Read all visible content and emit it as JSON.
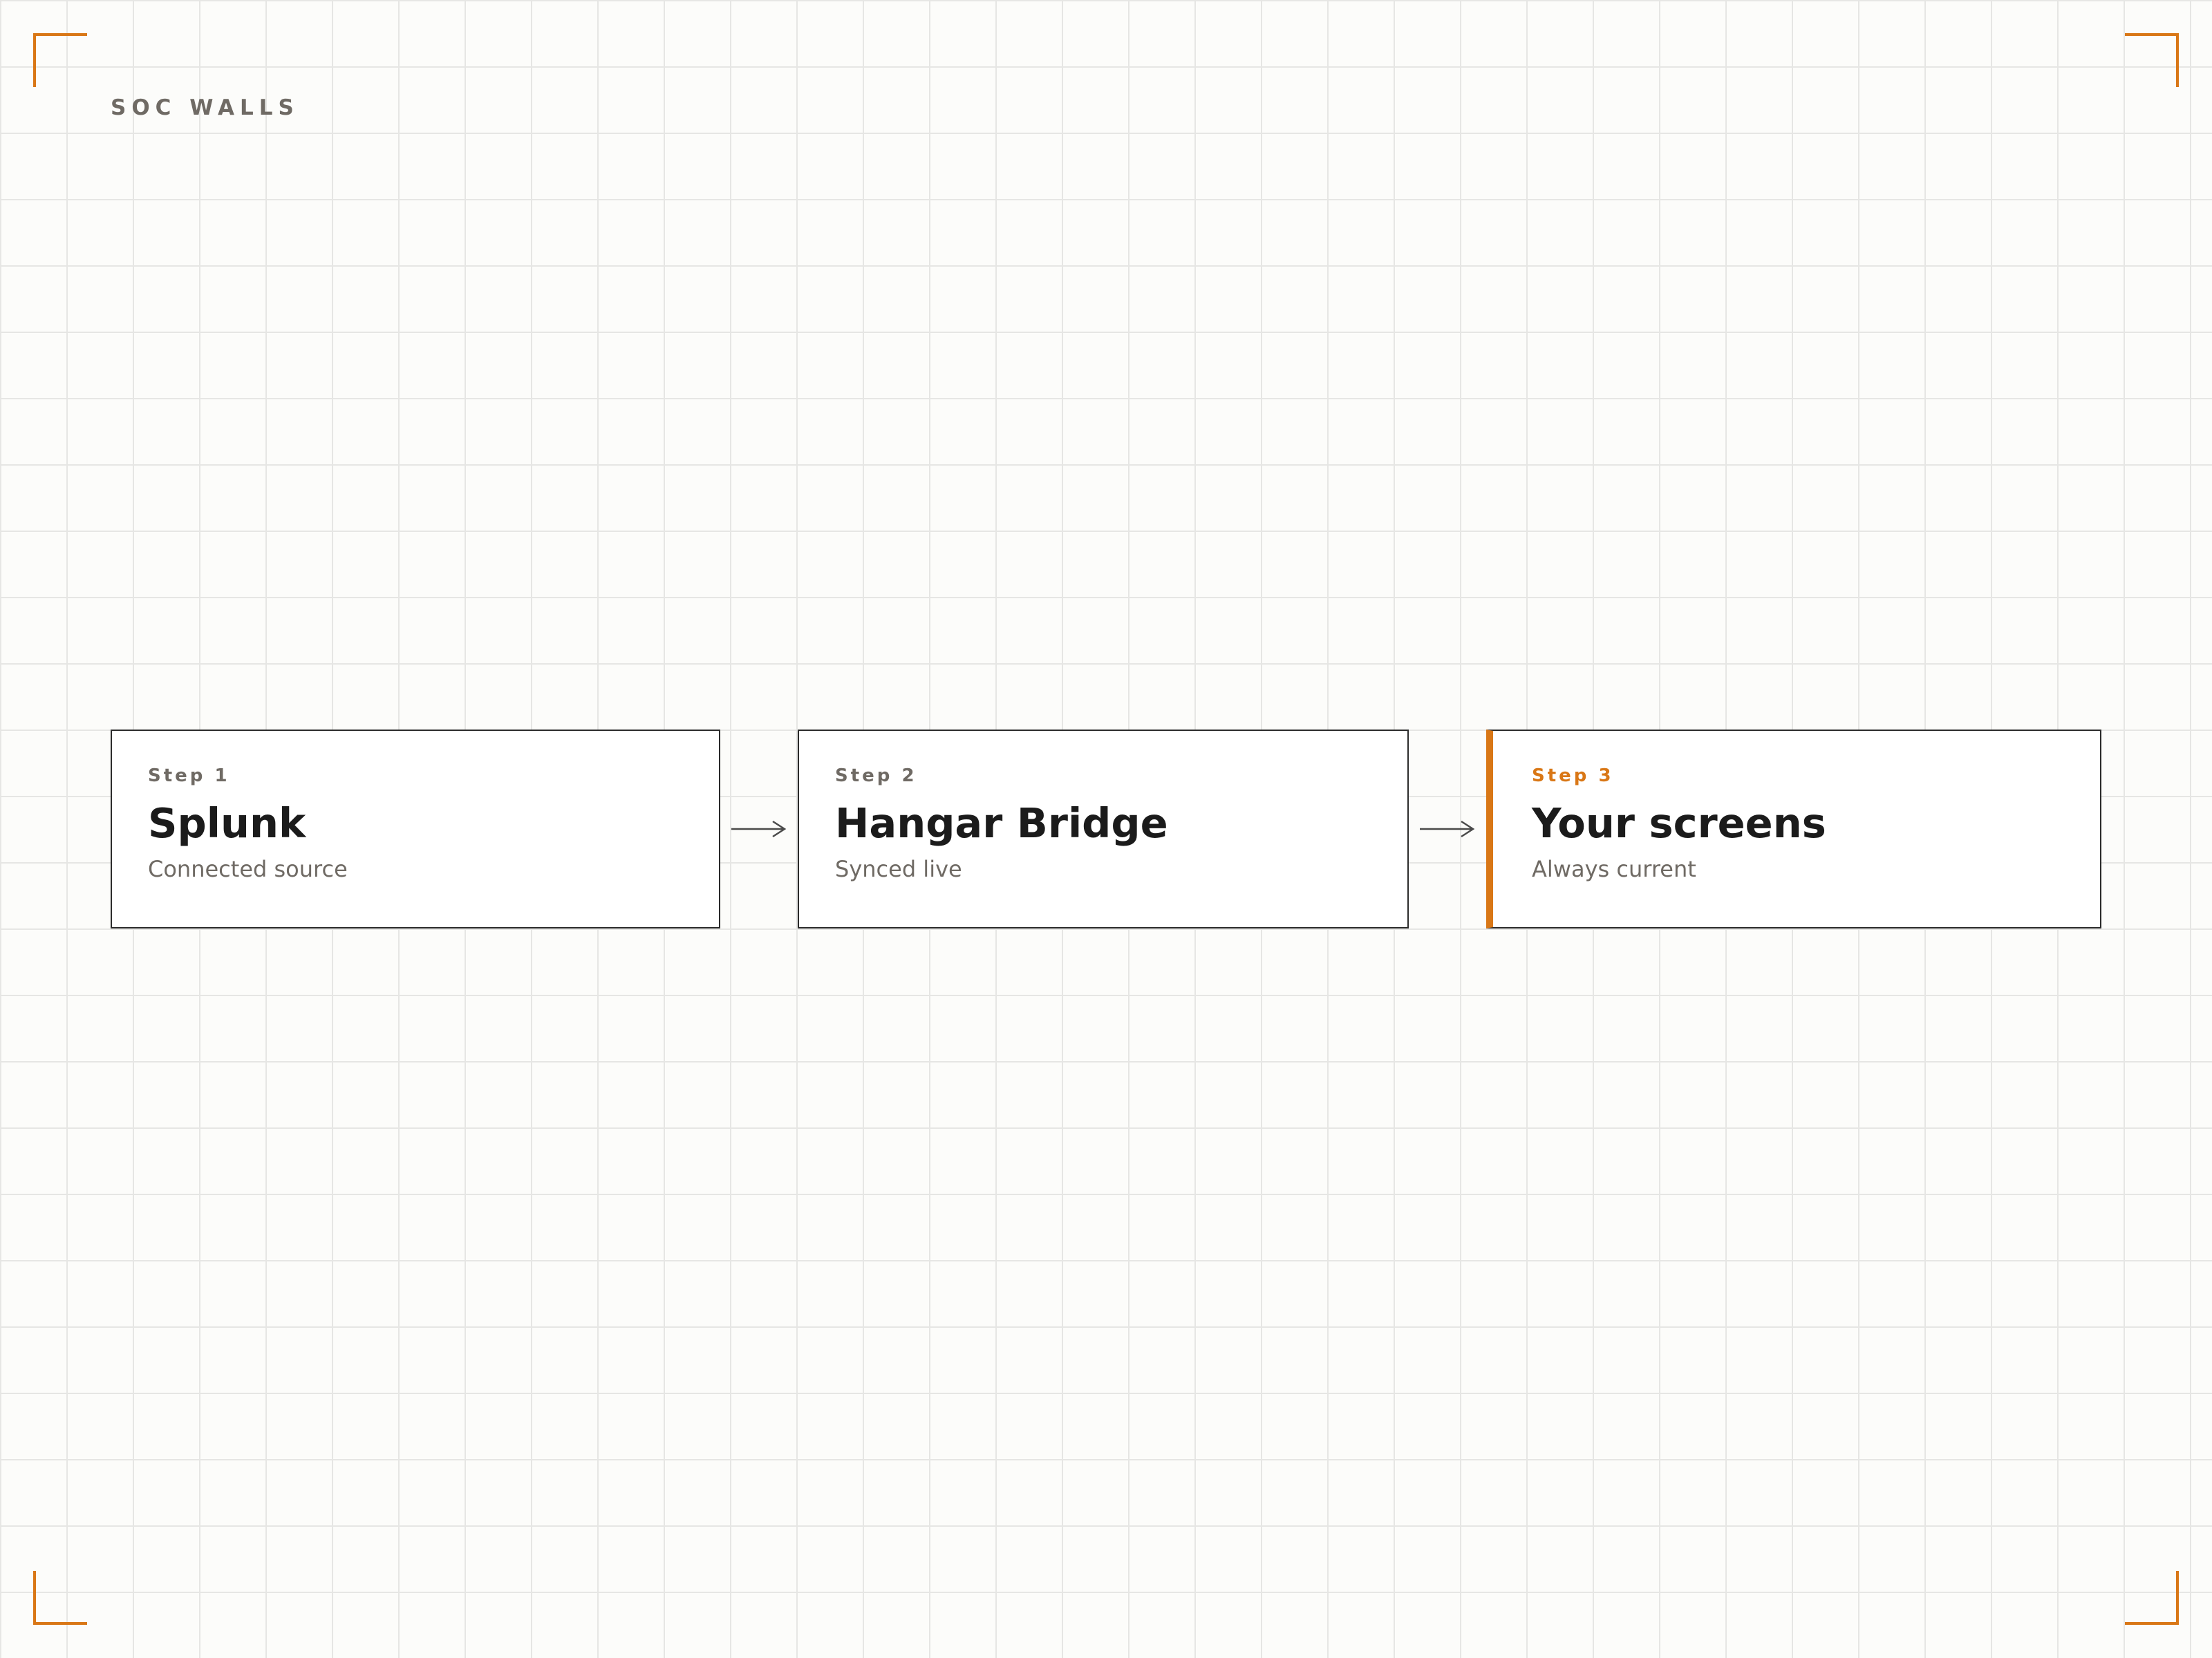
{
  "header": {
    "brand": "SOC WALLS"
  },
  "flow": {
    "steps": [
      {
        "step": "Step 1",
        "title": "Splunk",
        "subtitle": "Connected source",
        "highlighted": false
      },
      {
        "step": "Step 2",
        "title": "Hangar Bridge",
        "subtitle": "Synced live",
        "highlighted": false
      },
      {
        "step": "Step 3",
        "title": "Your screens",
        "subtitle": "Always current",
        "highlighted": true
      }
    ],
    "connectors": [
      "arrow-right-icon",
      "arrow-right-icon"
    ]
  },
  "colors": {
    "accent": "#d97716",
    "text_primary": "#1b1b1b",
    "text_muted": "#6f6a64",
    "border": "#2b2b2b",
    "background": "#fcfcfa",
    "grid": "#e6e6e4"
  }
}
